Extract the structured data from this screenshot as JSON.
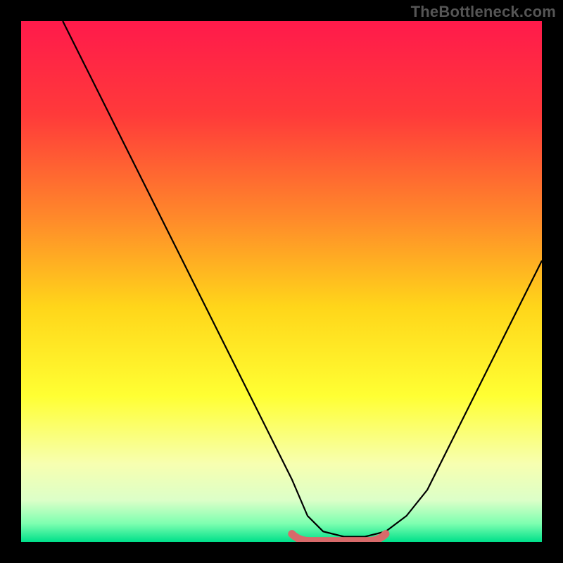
{
  "watermark": "TheBottleneck.com",
  "colors": {
    "bg": "#000000",
    "watermark_text": "#555555",
    "curve": "#000000",
    "marker": "#d86a6a",
    "gradient_stops": [
      {
        "offset": 0.0,
        "color": "#ff1a4b"
      },
      {
        "offset": 0.18,
        "color": "#ff3a3a"
      },
      {
        "offset": 0.38,
        "color": "#ff8a2a"
      },
      {
        "offset": 0.55,
        "color": "#ffd61a"
      },
      {
        "offset": 0.72,
        "color": "#ffff33"
      },
      {
        "offset": 0.85,
        "color": "#f7ffb0"
      },
      {
        "offset": 0.92,
        "color": "#dcffc8"
      },
      {
        "offset": 0.965,
        "color": "#7dffb0"
      },
      {
        "offset": 1.0,
        "color": "#00e08a"
      }
    ]
  },
  "chart_data": {
    "type": "line",
    "title": "",
    "xlabel": "",
    "ylabel": "",
    "xlim": [
      0,
      100
    ],
    "ylim": [
      0,
      100
    ],
    "series": [
      {
        "name": "bottleneck-curve",
        "x": [
          8,
          12,
          16,
          20,
          24,
          28,
          32,
          36,
          40,
          44,
          48,
          52,
          55,
          58,
          62,
          66,
          70,
          74,
          78,
          82,
          86,
          90,
          94,
          98,
          100
        ],
        "y": [
          100,
          92,
          84,
          76,
          68,
          60,
          52,
          44,
          36,
          28,
          20,
          12,
          5,
          2,
          1,
          1,
          2,
          5,
          10,
          18,
          26,
          34,
          42,
          50,
          54
        ]
      }
    ],
    "marker_region": {
      "x_start": 52,
      "x_end": 70,
      "y": 1
    }
  }
}
